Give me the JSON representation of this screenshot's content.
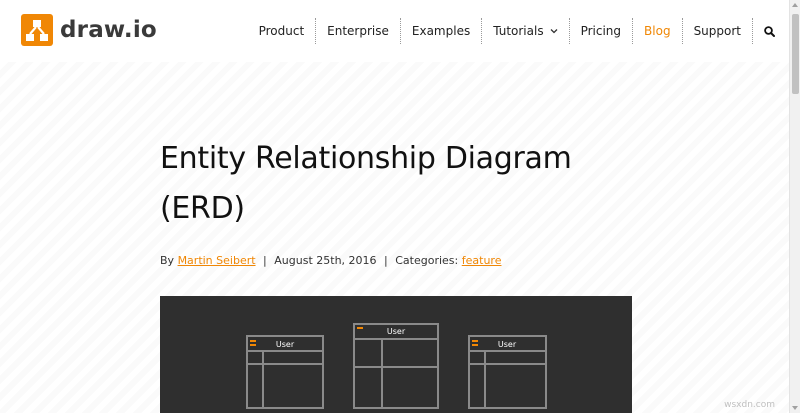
{
  "brand": {
    "name": "draw.io",
    "color": "#f08705"
  },
  "nav": {
    "items": [
      {
        "label": "Product"
      },
      {
        "label": "Enterprise"
      },
      {
        "label": "Examples"
      },
      {
        "label": "Tutorials",
        "has_dropdown": true
      },
      {
        "label": "Pricing"
      },
      {
        "label": "Blog",
        "active": true
      },
      {
        "label": "Support"
      }
    ],
    "search_icon": "search-icon"
  },
  "article": {
    "title_line1": "Entity Relationship Diagram",
    "title_line2": "(ERD)",
    "by_label": "By",
    "author": "Martin Seibert",
    "date": "August 25th, 2016",
    "categories_label": "Categories:",
    "category": "feature",
    "separator": "|"
  },
  "diagram": {
    "tables": [
      {
        "header": "User",
        "has_key_icon": true
      },
      {
        "header": "User",
        "has_key_icon": false
      },
      {
        "header": "User",
        "has_key_icon": true
      }
    ],
    "background": "#2f2f2f",
    "line_color": "#8a8a8a"
  },
  "watermark": "wsxdn.com"
}
